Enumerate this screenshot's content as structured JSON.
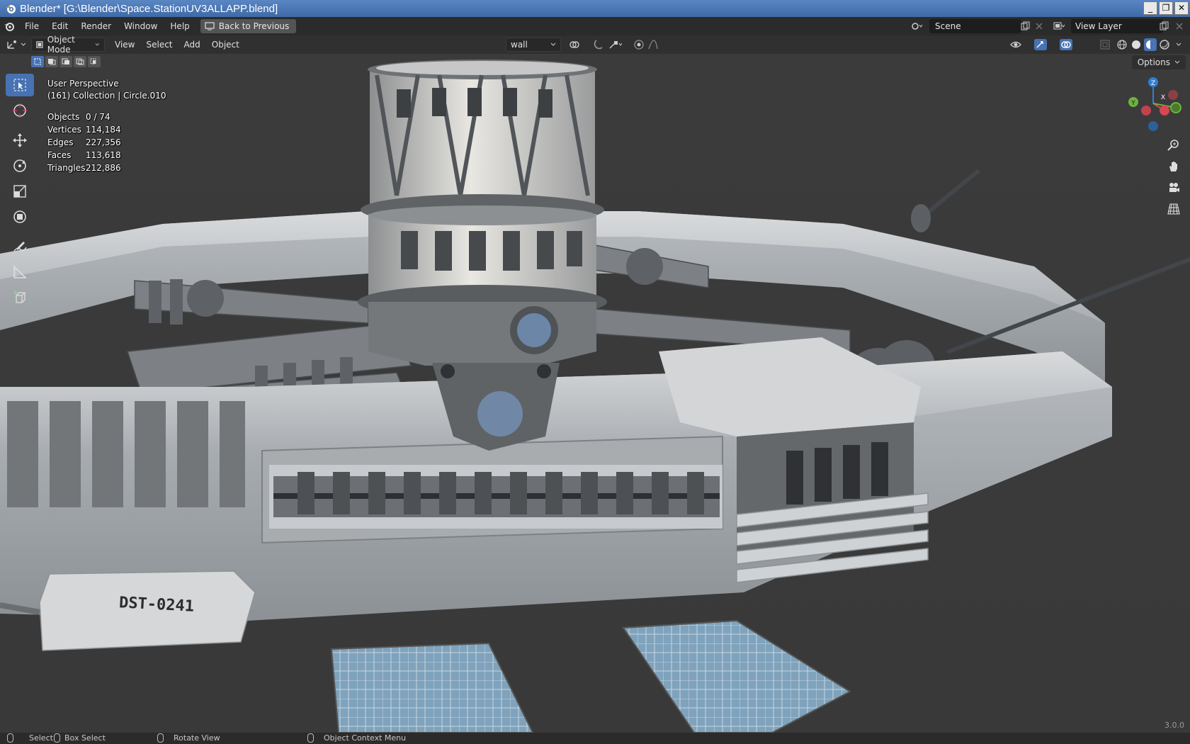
{
  "window": {
    "title": "Blender* [G:\\Blender\\Space.StationUV3ALLAPP.blend]",
    "buttons": [
      "_",
      "❐",
      "✕"
    ]
  },
  "topbar": {
    "menus": [
      "File",
      "Edit",
      "Render",
      "Window",
      "Help"
    ],
    "back_button": "Back to Previous",
    "scene_name": "Scene",
    "view_layer": "View Layer"
  },
  "viewport_header": {
    "mode": "Object Mode",
    "menus": [
      "View",
      "Select",
      "Add",
      "Object"
    ],
    "material_slot": "wall",
    "options": "Options"
  },
  "viewport": {
    "perspective": "User Perspective",
    "collection_info": "(161) Collection | Circle.010",
    "stats": [
      {
        "label": "Objects",
        "value": "0 / 74"
      },
      {
        "label": "Vertices",
        "value": "114,184"
      },
      {
        "label": "Edges",
        "value": "227,356"
      },
      {
        "label": "Faces",
        "value": "113,618"
      },
      {
        "label": "Triangles",
        "value": "212,886"
      }
    ],
    "hull_label": "DST-0241",
    "gizmo_axes": {
      "z": "Z",
      "y": "Y",
      "x": "X"
    },
    "version": "3.0.0"
  },
  "statusbar": {
    "select": "Select",
    "box_select": "Box Select",
    "rotate": "Rotate View",
    "context_menu": "Object Context Menu"
  },
  "colors": {
    "accent": "#4772b3",
    "titlebar": "#4a78b8",
    "viewport_bg": "#3a3a3a",
    "hull": "#c9cccf",
    "hull_dark": "#6f7378",
    "solar": "#6a8ea8"
  }
}
